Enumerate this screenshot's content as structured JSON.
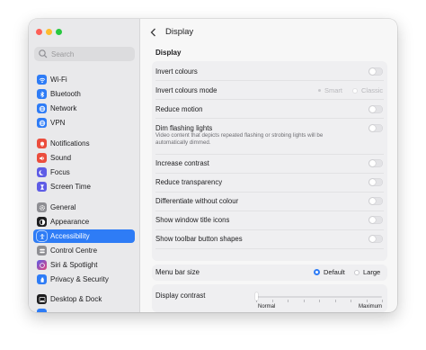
{
  "sidebar": {
    "search_placeholder": "Search",
    "items": [
      {
        "label": "Wi-Fi",
        "icon": "wifi-icon",
        "color": "#2e7cf6"
      },
      {
        "label": "Bluetooth",
        "icon": "bluetooth-icon",
        "color": "#2e7cf6"
      },
      {
        "label": "Network",
        "icon": "globe-icon",
        "color": "#2e7cf6"
      },
      {
        "label": "VPN",
        "icon": "globe-icon",
        "color": "#2e7cf6"
      },
      {
        "label": "Notifications",
        "icon": "bell-icon",
        "color": "#eb4d3d"
      },
      {
        "label": "Sound",
        "icon": "speaker-icon",
        "color": "#eb4d3d"
      },
      {
        "label": "Focus",
        "icon": "moon-icon",
        "color": "#5e5ce6"
      },
      {
        "label": "Screen Time",
        "icon": "hourglass-icon",
        "color": "#5e5ce6"
      },
      {
        "label": "General",
        "icon": "gear-icon",
        "color": "#8e8e93"
      },
      {
        "label": "Appearance",
        "icon": "appearance-icon",
        "color": "#1d1d1f"
      },
      {
        "label": "Accessibility",
        "icon": "accessibility-icon",
        "color": "#2e7cf6",
        "selected": true
      },
      {
        "label": "Control Centre",
        "icon": "control-centre-icon",
        "color": "#8e8e93"
      },
      {
        "label": "Siri & Spotlight",
        "icon": "siri-icon",
        "color": "#c04cd6"
      },
      {
        "label": "Privacy & Security",
        "icon": "hand-icon",
        "color": "#2e7cf6"
      },
      {
        "label": "Desktop & Dock",
        "icon": "dock-icon",
        "color": "#1d1d1f"
      }
    ]
  },
  "header": {
    "title": "Display"
  },
  "section_title": "Display",
  "settings": {
    "invert_colours": "Invert colours",
    "invert_mode": {
      "label": "Invert colours mode",
      "options": [
        "Smart",
        "Classic"
      ]
    },
    "reduce_motion": "Reduce motion",
    "dim_flashing": {
      "label": "Dim flashing lights",
      "description": "Video content that depicts repeated flashing or strobing lights will be automatically dimmed."
    },
    "increase_contrast": "Increase contrast",
    "reduce_transparency": "Reduce transparency",
    "differentiate": "Differentiate without colour",
    "window_title_icons": "Show window title icons",
    "toolbar_shapes": "Show toolbar button shapes",
    "menu_bar_size": {
      "label": "Menu bar size",
      "options": [
        "Default",
        "Large"
      ],
      "selected": "Default"
    },
    "display_contrast": {
      "label": "Display contrast",
      "min_label": "Normal",
      "max_label": "Maximum",
      "value": 0
    }
  },
  "colors": {
    "accent": "#2e7cf6",
    "close": "#fe5f57",
    "minimize": "#febc2e",
    "zoom": "#28c840"
  }
}
